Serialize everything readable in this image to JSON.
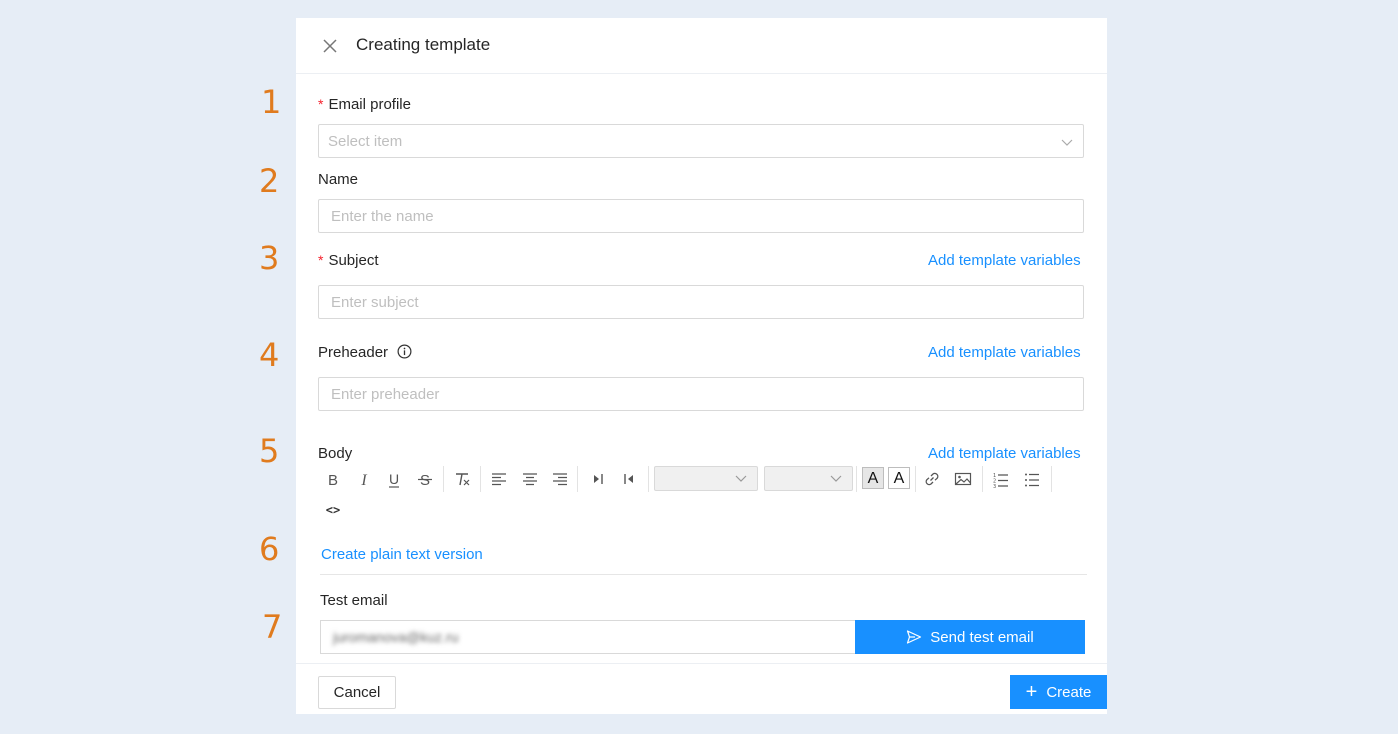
{
  "steps": [
    "1",
    "2",
    "3",
    "4",
    "5",
    "6",
    "7"
  ],
  "header": {
    "title": "Creating template"
  },
  "email_profile": {
    "label": "Email profile",
    "required_mark": "*",
    "placeholder": "Select item"
  },
  "name": {
    "label": "Name",
    "placeholder": "Enter the name"
  },
  "subject": {
    "label": "Subject",
    "required_mark": "*",
    "placeholder": "Enter subject",
    "variables_link": "Add template variables"
  },
  "preheader": {
    "label": "Preheader",
    "placeholder": "Enter preheader",
    "variables_link": "Add template variables"
  },
  "body": {
    "label": "Body",
    "variables_link": "Add template variables",
    "toolbar": {
      "bold": "B",
      "italic": "I",
      "underline": "U",
      "strike": "S",
      "font_color": "A",
      "background_color": "A",
      "code": "<>"
    }
  },
  "plain_text_link": "Create plain text version",
  "test_email": {
    "label": "Test email",
    "value": "juromanova@kuz.ru",
    "send_label": "Send test email"
  },
  "footer": {
    "cancel_label": "Cancel",
    "create_label": "Create",
    "create_icon": "+"
  },
  "colors": {
    "accent": "#1890ff",
    "step_numbers": "#e07b1e",
    "required": "#f5222d",
    "background": "#e6edf6"
  }
}
